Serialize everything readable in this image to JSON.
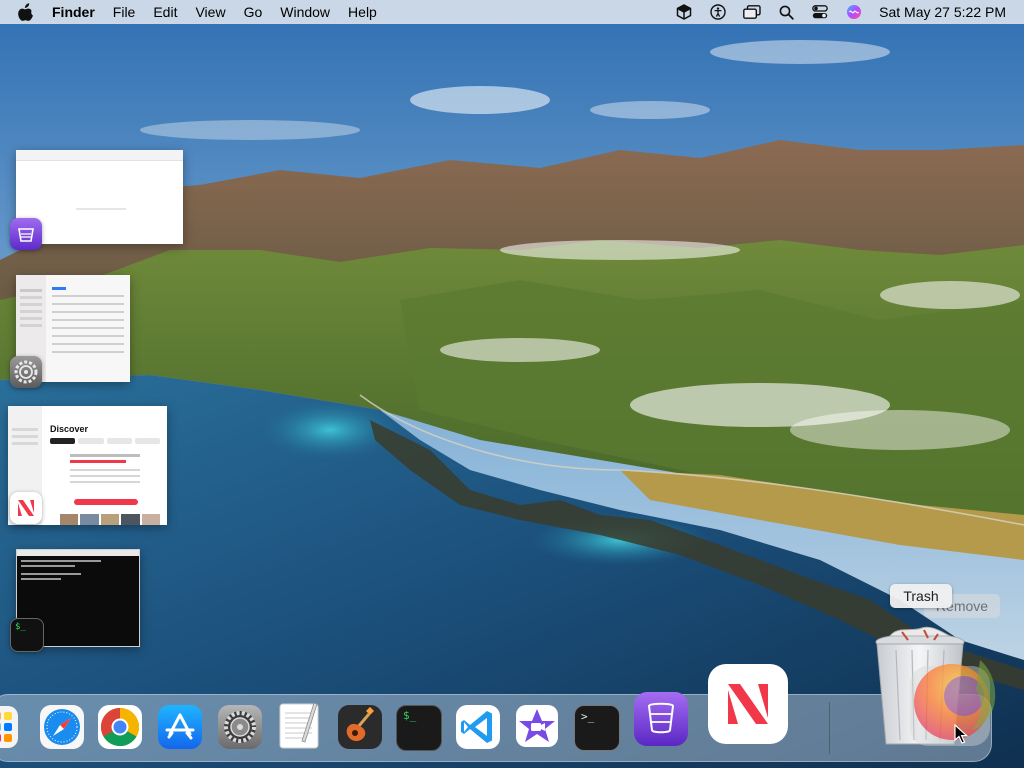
{
  "menubar": {
    "app_name": "Finder",
    "menus": [
      "File",
      "Edit",
      "View",
      "Go",
      "Window",
      "Help"
    ],
    "clock": "Sat May 27  5:22 PM",
    "status_icons": [
      "box-icon",
      "accessibility-icon",
      "display-mirror-icon",
      "search-icon",
      "control-center-icon",
      "siri-icon"
    ]
  },
  "stage_manager": {
    "windows": [
      {
        "app": "Apple Configurator",
        "icon": "configurator-icon"
      },
      {
        "app": "System Settings",
        "icon": "settings-gear-icon"
      },
      {
        "app": "News",
        "icon": "news-icon",
        "headline": "Discover"
      },
      {
        "app": "Terminal",
        "icon": "terminal-icon",
        "prompt": "$_"
      }
    ]
  },
  "dock": {
    "apps": [
      {
        "name": "Launchpad",
        "icon": "launchpad-icon"
      },
      {
        "name": "Safari",
        "icon": "safari-icon"
      },
      {
        "name": "Google Chrome",
        "icon": "chrome-icon"
      },
      {
        "name": "App Store",
        "icon": "app-store-icon"
      },
      {
        "name": "System Settings",
        "icon": "settings-gear-icon"
      },
      {
        "name": "TextEdit",
        "icon": "textedit-icon"
      },
      {
        "name": "GarageBand",
        "icon": "garageband-icon"
      },
      {
        "name": "Script Editor",
        "icon": "script-editor-icon",
        "label": "$_"
      },
      {
        "name": "Visual Studio Code",
        "icon": "vscode-icon"
      },
      {
        "name": "iMovie",
        "icon": "imovie-icon"
      },
      {
        "name": "Terminal",
        "icon": "terminal-icon",
        "label": ">_"
      },
      {
        "name": "Apple Configurator",
        "icon": "configurator-icon"
      },
      {
        "name": "News",
        "icon": "news-icon"
      }
    ],
    "trash_label": "Trash",
    "remove_label": "Remove"
  },
  "colors": {
    "menubar": "#eceef2",
    "news_red": "#f0384a",
    "configurator_purple": "#7b4bd6",
    "terminal_bg": "#111111"
  }
}
